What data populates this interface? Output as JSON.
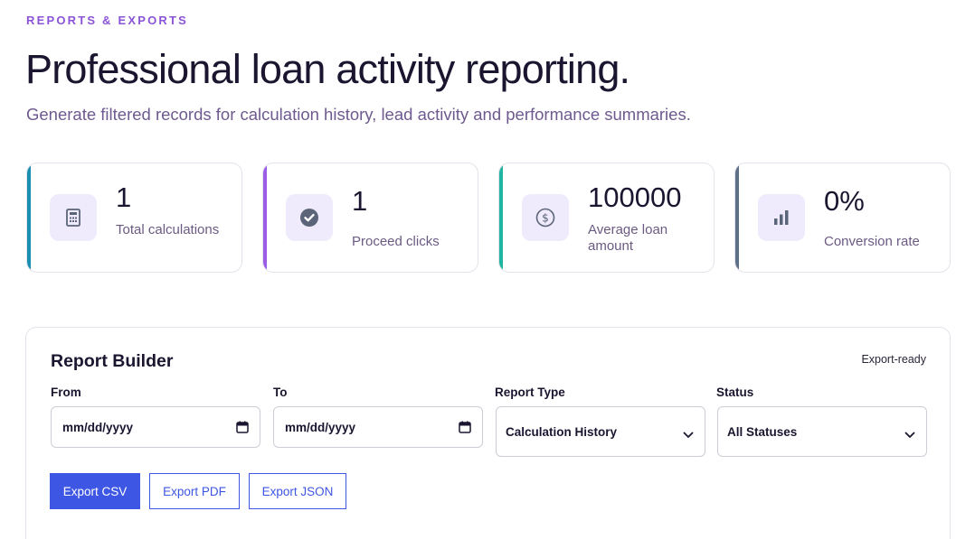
{
  "header": {
    "eyebrow": "REPORTS & EXPORTS",
    "title": "Professional loan activity reporting.",
    "subtitle": "Generate filtered records for calculation history, lead activity and performance summaries."
  },
  "stats": [
    {
      "value": "1",
      "label": "Total calculations",
      "icon": "calculator-icon",
      "accent": "#1a8fb0"
    },
    {
      "value": "1",
      "label": "Proceed clicks",
      "icon": "check-circle-icon",
      "accent": "#9b5de5"
    },
    {
      "value": "100000",
      "label": "Average loan amount",
      "icon": "dollar-circle-icon",
      "accent": "#1fb5a0"
    },
    {
      "value": "0%",
      "label": "Conversion rate",
      "icon": "bar-chart-icon",
      "accent": "#5f7089"
    }
  ],
  "builder": {
    "title": "Report Builder",
    "tag": "Export-ready",
    "from_label": "From",
    "from_placeholder": "mm/dd/yyyy",
    "to_label": "To",
    "to_placeholder": "mm/dd/yyyy",
    "report_type_label": "Report Type",
    "report_type_value": "Calculation History",
    "status_label": "Status",
    "status_value": "All Statuses",
    "export_csv": "Export CSV",
    "export_pdf": "Export PDF",
    "export_json": "Export JSON"
  },
  "colors": {
    "eyebrow": "#8b54d6",
    "icon_bg": "#efeafc",
    "icon_fg": "#5b6478",
    "primary": "#3d56e3"
  }
}
